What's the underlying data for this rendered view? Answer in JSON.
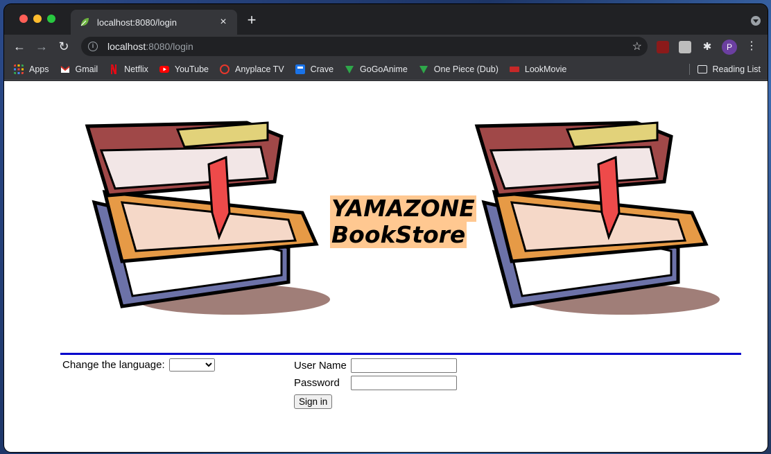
{
  "browser": {
    "tab": {
      "title": "localhost:8080/login",
      "close_label": "×"
    },
    "new_tab_label": "+",
    "url": {
      "host": "localhost",
      "rest": ":8080/login"
    },
    "profile_initial": "P",
    "bookmarks": [
      {
        "label": "Apps",
        "icon": "apps-grid-icon",
        "color": "#ea4335"
      },
      {
        "label": "Gmail",
        "icon": "gmail-icon",
        "color": "#d93025"
      },
      {
        "label": "Netflix",
        "icon": "netflix-icon",
        "color": "#e50914"
      },
      {
        "label": "YouTube",
        "icon": "youtube-icon",
        "color": "#ff0000"
      },
      {
        "label": "Anyplace TV",
        "icon": "anyplace-icon",
        "color": "#e8372c"
      },
      {
        "label": "Crave",
        "icon": "crave-icon",
        "color": "#1a73e8"
      },
      {
        "label": "GoGoAnime",
        "icon": "tv-icon",
        "color": "#2ea84a"
      },
      {
        "label": "One Piece (Dub)",
        "icon": "tv-icon",
        "color": "#2ea84a"
      },
      {
        "label": "LookMovie",
        "icon": "lookmovie-icon",
        "color": "#c62828"
      }
    ],
    "reading_list": "Reading List"
  },
  "page": {
    "title_line1": "YAMAZONE",
    "title_line2": "BookStore",
    "language_label": "Change the language:",
    "language_selected": "",
    "username_label": "User Name",
    "username_value": "",
    "password_label": "Password",
    "password_value": "",
    "signin_label": "Sign in"
  },
  "colors": {
    "title_highlight": "#ffc891",
    "divider": "#0000cc"
  }
}
